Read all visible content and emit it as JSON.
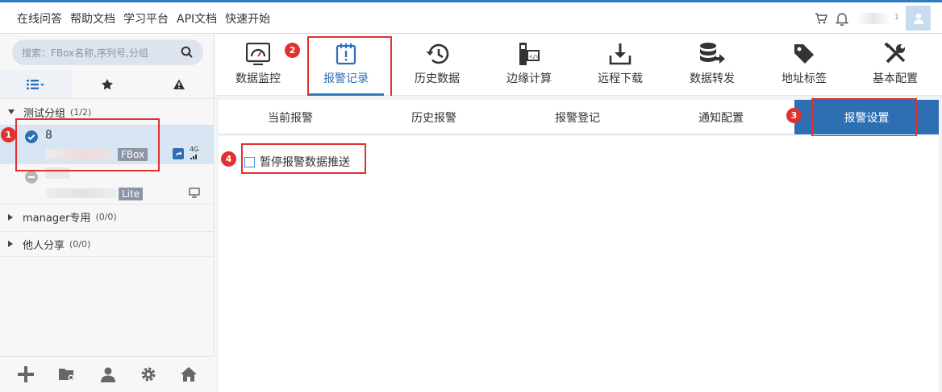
{
  "topnav": [
    "在线问答",
    "帮助文档",
    "学习平台",
    "API文档",
    "快速开始"
  ],
  "user": {
    "name_tail": "1"
  },
  "search": {
    "placeholder": "搜索：FBox名称,序列号,分组"
  },
  "groups": [
    {
      "name": "测试分组",
      "count": "(1/2)",
      "expanded": true
    },
    {
      "name": "manager专用",
      "count": "(0/0)",
      "expanded": false
    },
    {
      "name": "他人分享",
      "count": "(0/0)",
      "expanded": false
    }
  ],
  "devices": [
    {
      "name": "8",
      "type": "FBox",
      "signal": "4G",
      "online": true
    },
    {
      "name": "",
      "type": "Lite",
      "online": false
    }
  ],
  "toolbar": [
    {
      "label": "数据监控",
      "icon": "monitor-icon"
    },
    {
      "label": "报警记录",
      "icon": "alarm-clipboard-icon",
      "active": true
    },
    {
      "label": "历史数据",
      "icon": "history-icon"
    },
    {
      "label": "边缘计算",
      "icon": "edge-compute-icon"
    },
    {
      "label": "远程下载",
      "icon": "download-icon"
    },
    {
      "label": "数据转发",
      "icon": "database-forward-icon"
    },
    {
      "label": "地址标签",
      "icon": "tag-icon"
    },
    {
      "label": "基本配置",
      "icon": "tools-icon"
    }
  ],
  "subtabs": [
    {
      "label": "当前报警"
    },
    {
      "label": "历史报警"
    },
    {
      "label": "报警登记"
    },
    {
      "label": "通知配置"
    },
    {
      "label": "报警设置",
      "active": true
    }
  ],
  "option": {
    "label": "暂停报警数据推送",
    "checked": false
  },
  "markers": [
    "1",
    "2",
    "3",
    "4"
  ],
  "colors": {
    "accent": "#2d6fb2",
    "highlight": "#e03131",
    "selected_row": "#d8e6f4"
  }
}
